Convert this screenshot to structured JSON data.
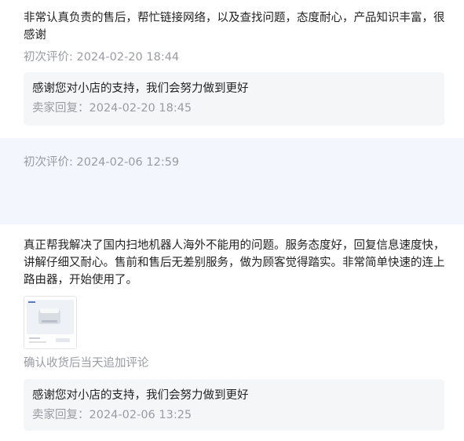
{
  "review1": {
    "text": "非常认真负责的售后，帮忙链接网络，以及查找问题，态度耐心，产品知识丰富，很感谢",
    "meta": "初次评价: 2024-02-20 18:44",
    "reply_text": "感谢您对小店的支持，我们会努力做到更好",
    "reply_meta": "卖家回复：2024-02-20 18:45"
  },
  "review2": {
    "meta": "初次评价: 2024-02-06 12:59"
  },
  "review3": {
    "text": "真正帮我解决了国内扫地机器人海外不能用的问题。服务态度好，回复信息速度快，讲解仔细又耐心。售前和售后无差别服务，做为顾客觉得踏实。非常简单快速的连上路由器，开始使用了。",
    "followup_label": "确认收货后当天追加评论",
    "reply_text": "感谢您对小店的支持，我们会努力做到更好",
    "reply_meta": "卖家回复：2024-02-06 13:25"
  },
  "colors": {
    "text": "#222222",
    "muted": "#9a9ca3",
    "reply_bg": "#f5f6f8",
    "highlight_bg": "#f3f6fd"
  }
}
